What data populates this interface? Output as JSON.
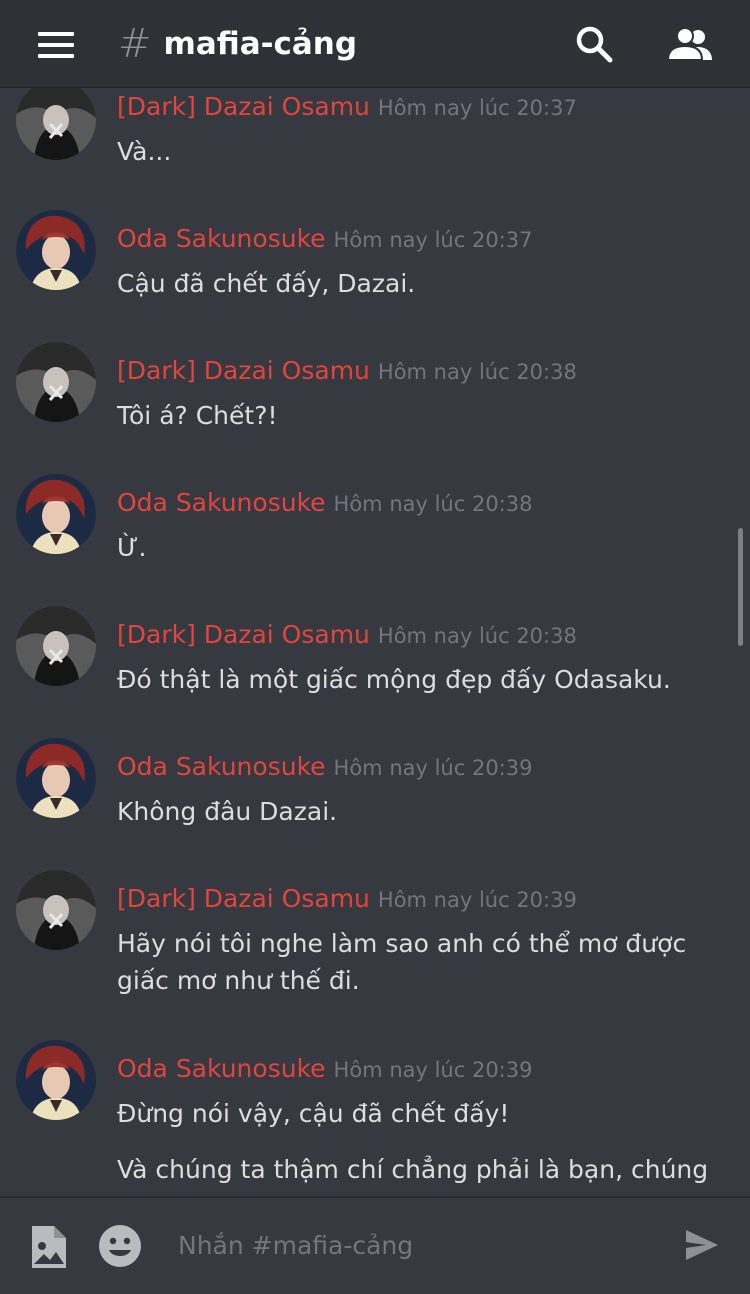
{
  "header": {
    "channel_name": "mafia-cảng",
    "hash": "#",
    "icons": [
      "menu-icon",
      "search-icon",
      "members-icon"
    ]
  },
  "messages": [
    {
      "author": "[Dark] Dazai Osamu",
      "timestamp": "Hôm nay lúc 20:37",
      "lines": [
        "Và..."
      ]
    },
    {
      "author": "Oda Sakunosuke",
      "timestamp": "Hôm nay lúc 20:37",
      "lines": [
        "Cậu đã chết đấy, Dazai."
      ]
    },
    {
      "author": "[Dark] Dazai Osamu",
      "timestamp": "Hôm nay lúc 20:38",
      "lines": [
        "Tôi á? Chết?!"
      ]
    },
    {
      "author": "Oda Sakunosuke",
      "timestamp": "Hôm nay lúc 20:38",
      "lines": [
        "Ừ."
      ]
    },
    {
      "author": "[Dark] Dazai Osamu",
      "timestamp": "Hôm nay lúc 20:38",
      "lines": [
        "Đó thật là một giấc mộng đẹp đấy Odasaku."
      ]
    },
    {
      "author": "Oda Sakunosuke",
      "timestamp": "Hôm nay lúc 20:39",
      "lines": [
        "Không đâu Dazai."
      ]
    },
    {
      "author": "[Dark] Dazai Osamu",
      "timestamp": "Hôm nay lúc 20:39",
      "lines": [
        "Hãy nói tôi nghe làm sao anh có thể mơ được giấc mơ như thế đi."
      ]
    },
    {
      "author": "Oda Sakunosuke",
      "timestamp": "Hôm nay lúc 20:39",
      "lines": [
        "Đừng nói vậy, cậu đã chết đấy!",
        "Và chúng ta thậm chí chẳng phải là bạn, chúng"
      ]
    }
  ],
  "composer": {
    "placeholder": "Nhắn #mafia-cảng",
    "icons": [
      "image-icon",
      "emoji-icon",
      "send-icon"
    ]
  },
  "colors": {
    "background": "#36393f",
    "header_bg": "#2f3136",
    "author": "#e0453f",
    "timestamp": "#72767d",
    "message_text": "#dcddde"
  }
}
